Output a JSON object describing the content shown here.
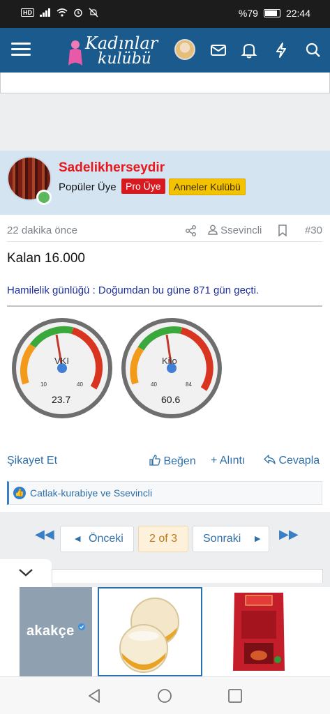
{
  "status_bar": {
    "network": "HD",
    "battery": "%79",
    "time": "22:44"
  },
  "app_bar": {
    "logo_line1": "Kadınlar",
    "logo_line2": "kulübü",
    "icons": [
      "menu-icon",
      "avatar",
      "mail-icon",
      "bell-icon",
      "bolt-icon",
      "search-icon"
    ]
  },
  "post": {
    "username": "Sadelikherseydir",
    "user_title": "Popüler Üye",
    "badges": [
      "Pro Üye",
      "Anneler Kulübü"
    ],
    "time_ago": "22 dakika önce",
    "quoted_user": "Ssevincli",
    "post_number": "#30",
    "message": "Kalan 16.000",
    "signature": "Hamilelik günlüğü : Doğumdan bu güne 871 gün geçti.",
    "gauges": [
      {
        "label": "VKI",
        "min_label": "10",
        "max_label": "40",
        "value": "23.7"
      },
      {
        "label": "Kilo",
        "min_label": "40",
        "max_label": "84",
        "value": "60.6"
      }
    ],
    "actions": {
      "report": "Şikayet Et",
      "like": "Beğen",
      "quote": "Alıntı",
      "reply": "Cevapla"
    },
    "likes": "Catlak-kurabiye ve Ssevincli"
  },
  "pagination": {
    "prev": "Önceki",
    "current": "2 of 3",
    "next": "Sonraki"
  },
  "ad": {
    "brand": "akakçe"
  },
  "colors": {
    "app_bar": "#1b5a8c",
    "username": "#e8191e",
    "pro_badge": "#d71920",
    "anneler_badge": "#f4c300",
    "link": "#2f6fa8"
  }
}
